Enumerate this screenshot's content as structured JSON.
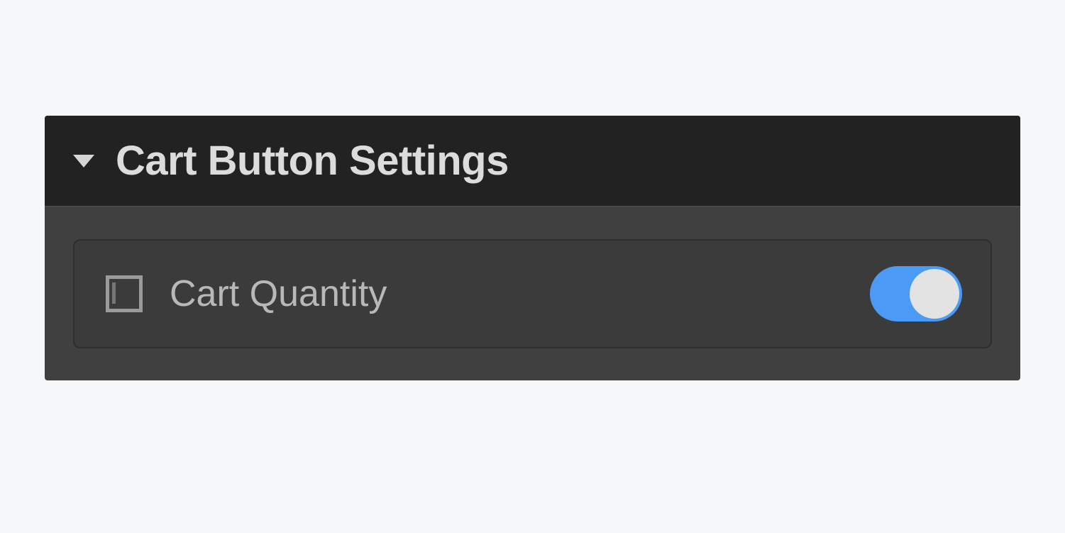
{
  "panel": {
    "title": "Cart Button Settings",
    "expanded": true,
    "settings": [
      {
        "label": "Cart Quantity",
        "enabled": true
      }
    ]
  },
  "colors": {
    "toggle_on": "#4a9af6",
    "panel_header": "#222222",
    "panel_body": "#404040"
  }
}
